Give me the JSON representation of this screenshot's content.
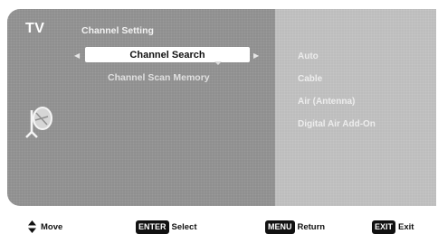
{
  "header": {
    "tv_label": "TV",
    "menu_title": "Channel Setting"
  },
  "menu": {
    "selected_item": "Channel Search",
    "items": [
      "Channel Scan Memory"
    ]
  },
  "options": [
    "Auto",
    "Cable",
    "Air (Antenna)",
    "Digital Air Add-On"
  ],
  "footer": {
    "move_label": "Move",
    "enter_key": "ENTER",
    "select_label": "Select",
    "menu_key": "MENU",
    "return_label": "Return",
    "exit_key": "EXIT",
    "exit_label": "Exit"
  },
  "icons": {
    "left_arrow": "left-arrow-icon",
    "right_arrow": "right-arrow-icon",
    "menu_icon": "satellite-dish-icon",
    "move_icon": "up-down-arrow-icon"
  }
}
